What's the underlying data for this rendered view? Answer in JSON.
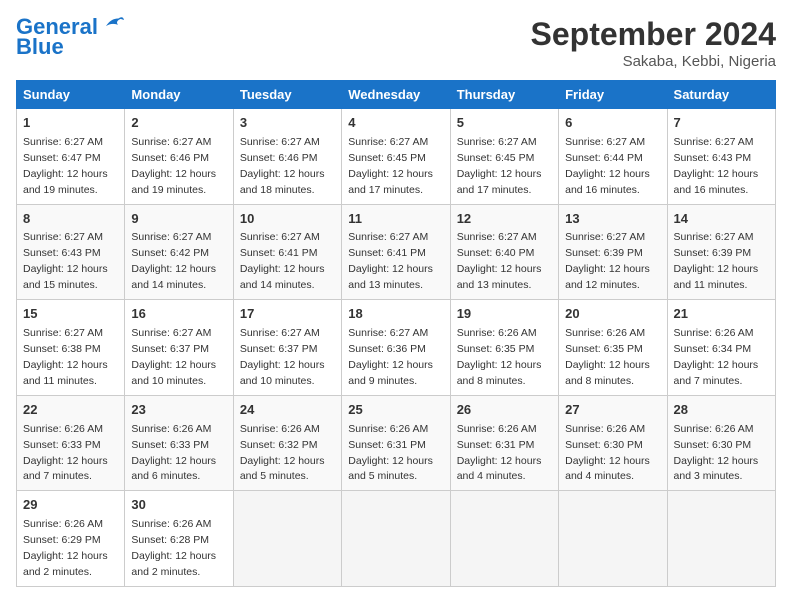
{
  "header": {
    "logo_line1": "General",
    "logo_line2": "Blue",
    "month": "September 2024",
    "location": "Sakaba, Kebbi, Nigeria"
  },
  "weekdays": [
    "Sunday",
    "Monday",
    "Tuesday",
    "Wednesday",
    "Thursday",
    "Friday",
    "Saturday"
  ],
  "weeks": [
    [
      {
        "day": "1",
        "sunrise": "6:27 AM",
        "sunset": "6:47 PM",
        "hours": "12",
        "minutes": "19"
      },
      {
        "day": "2",
        "sunrise": "6:27 AM",
        "sunset": "6:46 PM",
        "hours": "12",
        "minutes": "19"
      },
      {
        "day": "3",
        "sunrise": "6:27 AM",
        "sunset": "6:46 PM",
        "hours": "12",
        "minutes": "18"
      },
      {
        "day": "4",
        "sunrise": "6:27 AM",
        "sunset": "6:45 PM",
        "hours": "12",
        "minutes": "17"
      },
      {
        "day": "5",
        "sunrise": "6:27 AM",
        "sunset": "6:45 PM",
        "hours": "12",
        "minutes": "17"
      },
      {
        "day": "6",
        "sunrise": "6:27 AM",
        "sunset": "6:44 PM",
        "hours": "12",
        "minutes": "16"
      },
      {
        "day": "7",
        "sunrise": "6:27 AM",
        "sunset": "6:43 PM",
        "hours": "12",
        "minutes": "16"
      }
    ],
    [
      {
        "day": "8",
        "sunrise": "6:27 AM",
        "sunset": "6:43 PM",
        "hours": "12",
        "minutes": "15"
      },
      {
        "day": "9",
        "sunrise": "6:27 AM",
        "sunset": "6:42 PM",
        "hours": "12",
        "minutes": "14"
      },
      {
        "day": "10",
        "sunrise": "6:27 AM",
        "sunset": "6:41 PM",
        "hours": "12",
        "minutes": "14"
      },
      {
        "day": "11",
        "sunrise": "6:27 AM",
        "sunset": "6:41 PM",
        "hours": "12",
        "minutes": "13"
      },
      {
        "day": "12",
        "sunrise": "6:27 AM",
        "sunset": "6:40 PM",
        "hours": "12",
        "minutes": "13"
      },
      {
        "day": "13",
        "sunrise": "6:27 AM",
        "sunset": "6:39 PM",
        "hours": "12",
        "minutes": "12"
      },
      {
        "day": "14",
        "sunrise": "6:27 AM",
        "sunset": "6:39 PM",
        "hours": "12",
        "minutes": "11"
      }
    ],
    [
      {
        "day": "15",
        "sunrise": "6:27 AM",
        "sunset": "6:38 PM",
        "hours": "12",
        "minutes": "11"
      },
      {
        "day": "16",
        "sunrise": "6:27 AM",
        "sunset": "6:37 PM",
        "hours": "12",
        "minutes": "10"
      },
      {
        "day": "17",
        "sunrise": "6:27 AM",
        "sunset": "6:37 PM",
        "hours": "12",
        "minutes": "10"
      },
      {
        "day": "18",
        "sunrise": "6:27 AM",
        "sunset": "6:36 PM",
        "hours": "12",
        "minutes": "9"
      },
      {
        "day": "19",
        "sunrise": "6:26 AM",
        "sunset": "6:35 PM",
        "hours": "12",
        "minutes": "8"
      },
      {
        "day": "20",
        "sunrise": "6:26 AM",
        "sunset": "6:35 PM",
        "hours": "12",
        "minutes": "8"
      },
      {
        "day": "21",
        "sunrise": "6:26 AM",
        "sunset": "6:34 PM",
        "hours": "12",
        "minutes": "7"
      }
    ],
    [
      {
        "day": "22",
        "sunrise": "6:26 AM",
        "sunset": "6:33 PM",
        "hours": "12",
        "minutes": "7"
      },
      {
        "day": "23",
        "sunrise": "6:26 AM",
        "sunset": "6:33 PM",
        "hours": "12",
        "minutes": "6"
      },
      {
        "day": "24",
        "sunrise": "6:26 AM",
        "sunset": "6:32 PM",
        "hours": "12",
        "minutes": "5"
      },
      {
        "day": "25",
        "sunrise": "6:26 AM",
        "sunset": "6:31 PM",
        "hours": "12",
        "minutes": "5"
      },
      {
        "day": "26",
        "sunrise": "6:26 AM",
        "sunset": "6:31 PM",
        "hours": "12",
        "minutes": "4"
      },
      {
        "day": "27",
        "sunrise": "6:26 AM",
        "sunset": "6:30 PM",
        "hours": "12",
        "minutes": "4"
      },
      {
        "day": "28",
        "sunrise": "6:26 AM",
        "sunset": "6:30 PM",
        "hours": "12",
        "minutes": "3"
      }
    ],
    [
      {
        "day": "29",
        "sunrise": "6:26 AM",
        "sunset": "6:29 PM",
        "hours": "12",
        "minutes": "2"
      },
      {
        "day": "30",
        "sunrise": "6:26 AM",
        "sunset": "6:28 PM",
        "hours": "12",
        "minutes": "2"
      },
      null,
      null,
      null,
      null,
      null
    ]
  ]
}
